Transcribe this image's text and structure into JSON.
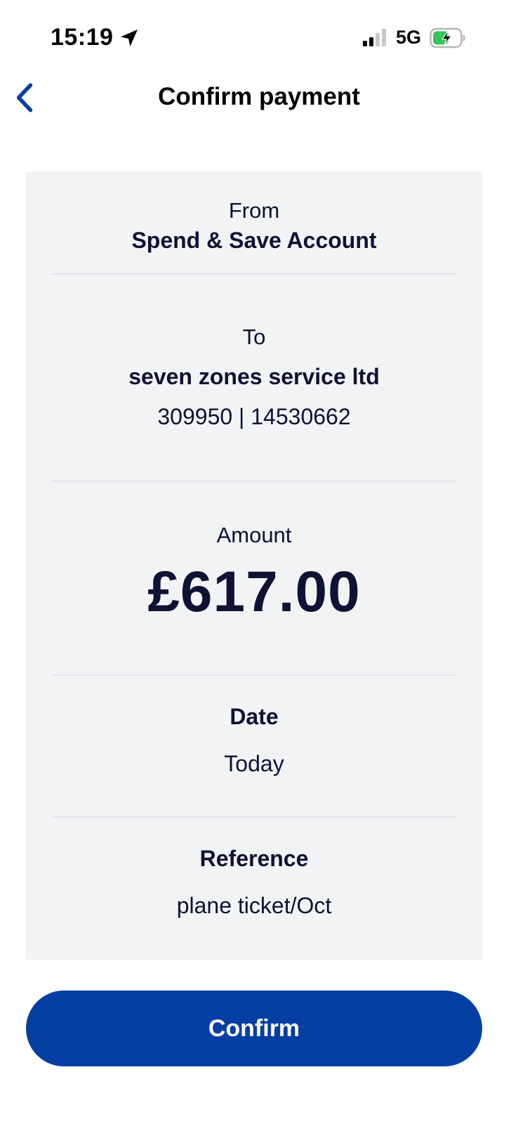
{
  "status_bar": {
    "time": "15:19",
    "network": "5G",
    "icons": [
      "location-arrow-icon",
      "signal-icon",
      "battery-charging-icon"
    ]
  },
  "header": {
    "title": "Confirm payment",
    "back_icon": "chevron-left-icon"
  },
  "payment": {
    "from_label": "From",
    "from_account": "Spend & Save Account",
    "to_label": "To",
    "payee_name": "seven zones service ltd",
    "payee_account": "309950 | 14530662",
    "amount_label": "Amount",
    "amount": "£617.00",
    "date_label": "Date",
    "date_value": "Today",
    "reference_label": "Reference",
    "reference_value": "plane ticket/Oct"
  },
  "actions": {
    "confirm_label": "Confirm"
  },
  "colors": {
    "accent": "#053ea3",
    "back_chevron": "#0a3fa8",
    "card_background": "#f2f3f5",
    "text": "#0e1233",
    "battery_green": "#34c759"
  }
}
